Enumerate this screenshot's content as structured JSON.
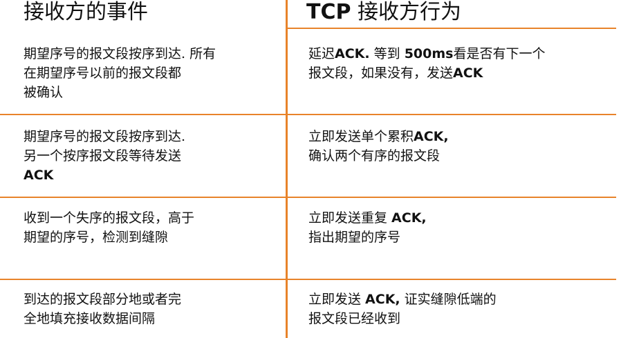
{
  "table": {
    "headers": {
      "left": "接收方的事件",
      "right_prefix": "TCP",
      "right_rest": " 接收方行为"
    },
    "rows": [
      {
        "event": [
          "期望序号的报文段按序到达. 所有",
          "在期望序号以前的报文段都",
          "被确认"
        ],
        "action": [
          {
            "p1": "延迟",
            "b1": "ACK.",
            "p2": " 等到 ",
            "b2": "500ms",
            "p3": "看是否有下一个"
          },
          {
            "p1": "报文段，如果没有，发送",
            "b1": "ACK",
            "p2": "",
            "b2": "",
            "p3": ""
          }
        ]
      },
      {
        "event": [
          "期望序号的报文段按序到达.",
          "另一个按序报文段等待发送",
          "ACK"
        ],
        "action": [
          {
            "p1": "立即发送单个累积",
            "b1": "ACK,",
            "p2": "",
            "b2": "",
            "p3": ""
          },
          {
            "p1": "确认两个有序的报文段",
            "b1": "",
            "p2": "",
            "b2": "",
            "p3": ""
          }
        ]
      },
      {
        "event": [
          "收到一个失序的报文段，高于",
          "期望的序号，检测到缝隙"
        ],
        "action": [
          {
            "p1": "立即发送重复 ",
            "b1": "ACK,",
            "p2": "",
            "b2": "",
            "p3": ""
          },
          {
            "p1": "指出期望的序号",
            "b1": "",
            "p2": "",
            "b2": "",
            "p3": ""
          }
        ]
      },
      {
        "event": [
          "到达的报文段部分地或者完",
          "全地填充接收数据间隔"
        ],
        "action": [
          {
            "p1": "立即发送 ",
            "b1": "ACK,",
            "p2": " 证实缝隙低端的",
            "b2": "",
            "p3": ""
          },
          {
            "p1": "报文段已经收到",
            "b1": "",
            "p2": "",
            "b2": "",
            "p3": ""
          }
        ]
      }
    ]
  },
  "colors": {
    "divider": "#E8832A",
    "text": "#111111"
  }
}
